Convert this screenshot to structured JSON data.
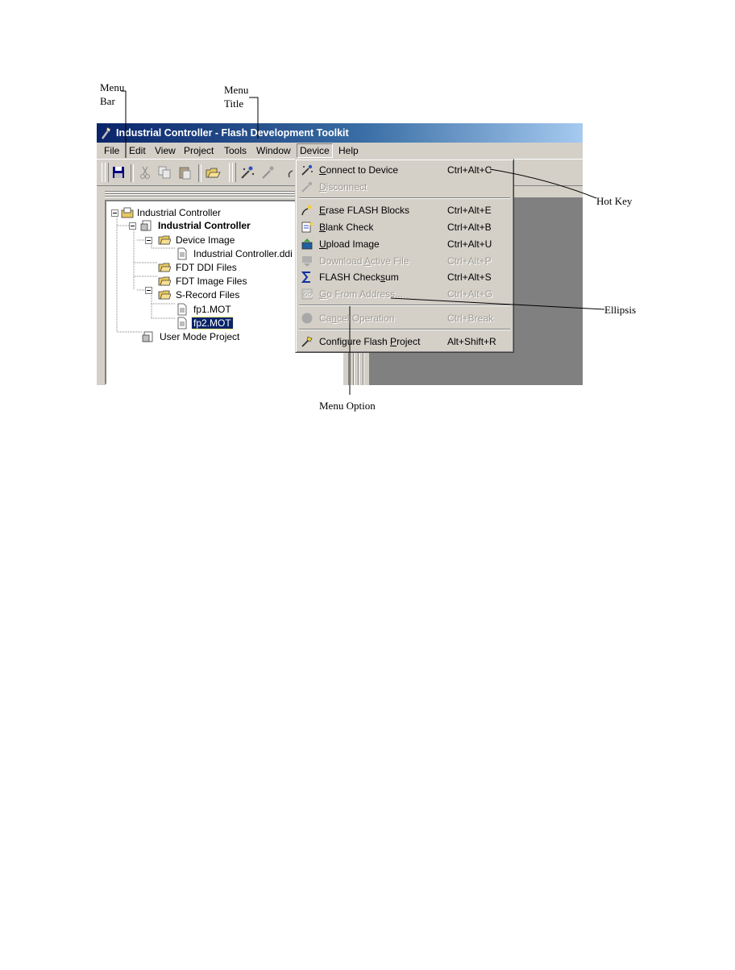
{
  "callouts": {
    "menu_bar": "Menu\nBar",
    "menu_title": "Menu\nTitle",
    "hot_key": "Hot Key",
    "ellipsis": "Ellipsis",
    "menu_option": "Menu Option"
  },
  "window": {
    "title": "Industrial Controller - Flash Development Toolkit"
  },
  "menubar": {
    "items": [
      "File",
      "Edit",
      "View",
      "Project",
      "Tools",
      "Window",
      "Device",
      "Help"
    ],
    "open_item": "Device"
  },
  "tree": {
    "nodes": [
      {
        "label": "Industrial Controller",
        "icon": "workspace-icon"
      },
      {
        "label": "Industrial Controller",
        "icon": "project-icon"
      },
      {
        "label": "Device Image",
        "icon": "folder-icon"
      },
      {
        "label": "Industrial Controller.ddi",
        "icon": "file-icon"
      },
      {
        "label": "FDT DDI Files",
        "icon": "folder-icon"
      },
      {
        "label": "FDT Image Files",
        "icon": "folder-icon"
      },
      {
        "label": "S-Record Files",
        "icon": "folder-icon"
      },
      {
        "label": "fp1.MOT",
        "icon": "file-icon"
      },
      {
        "label": "fp2.MOT",
        "icon": "file-icon"
      },
      {
        "label": "User Mode Project",
        "icon": "project-icon"
      }
    ]
  },
  "device_menu": {
    "items": [
      {
        "pre": "",
        "u": "C",
        "post": "onnect to Device",
        "hotkey": "Ctrl+Alt+C",
        "enabled": true,
        "icon": "connect-icon"
      },
      {
        "pre": "",
        "u": "D",
        "post": "isconnect",
        "hotkey": "",
        "enabled": false,
        "icon": "disconnect-icon"
      },
      {
        "pre": "",
        "u": "E",
        "post": "rase FLASH Blocks",
        "hotkey": "Ctrl+Alt+E",
        "enabled": true,
        "icon": "erase-icon"
      },
      {
        "pre": "",
        "u": "B",
        "post": "lank Check",
        "hotkey": "Ctrl+Alt+B",
        "enabled": true,
        "icon": "blank-check-icon"
      },
      {
        "pre": "",
        "u": "U",
        "post": "pload Image",
        "hotkey": "Ctrl+Alt+U",
        "enabled": true,
        "icon": "upload-icon"
      },
      {
        "pre": "Download ",
        "u": "A",
        "post": "ctive File",
        "hotkey": "Ctrl+Alt+P",
        "enabled": false,
        "icon": "download-icon"
      },
      {
        "pre": "FLASH Check",
        "u": "s",
        "post": "um",
        "hotkey": "Ctrl+Alt+S",
        "enabled": true,
        "icon": "checksum-icon"
      },
      {
        "pre": "",
        "u": "G",
        "post": "o From Address...",
        "hotkey": "Ctrl+Alt+G",
        "enabled": false,
        "icon": "goto-icon"
      },
      {
        "pre": "Ca",
        "u": "n",
        "post": "cel Operation",
        "hotkey": "Ctrl+Break",
        "enabled": false,
        "icon": "cancel-icon"
      },
      {
        "pre": "Configure Flash ",
        "u": "P",
        "post": "roject",
        "hotkey": "Alt+Shift+R",
        "enabled": true,
        "icon": "configure-icon"
      }
    ]
  },
  "colors": {
    "titlebar_start": "#0a246a",
    "titlebar_end": "#a6caf0",
    "window_face": "#d4d0c8",
    "selection": "#0a246a",
    "mdi_background": "#808080"
  }
}
